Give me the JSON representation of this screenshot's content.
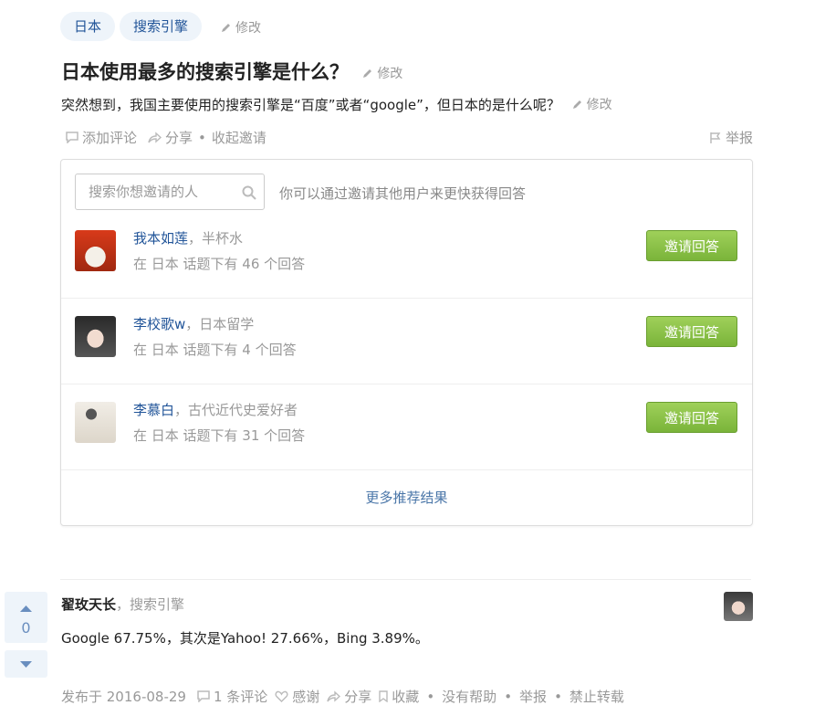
{
  "tags": [
    "日本",
    "搜索引擎"
  ],
  "edit_label": "修改",
  "question": {
    "title": "日本使用最多的搜索引擎是什么？",
    "detail": "突然想到，我国主要使用的搜索引擎是“百度”或者“google”，但日本的是什么呢？"
  },
  "actions": {
    "comment": "添加评论",
    "share": "分享",
    "dot": "•",
    "collapse_invite": "收起邀请",
    "report": "举报"
  },
  "invite_panel": {
    "search_placeholder": "搜索你想邀请的人",
    "hint": "你可以通过邀请其他用户来更快获得回答",
    "invite_button": "邀请回答",
    "more": "更多推荐结果",
    "people": [
      {
        "name": "我本如莲",
        "sep": "，",
        "bio": "半杯水",
        "stat": "在 日本 话题下有 46 个回答"
      },
      {
        "name": "李校歌w",
        "sep": "，",
        "bio": "日本留学",
        "stat": "在 日本 话题下有 4 个回答"
      },
      {
        "name": "李慕白",
        "sep": "，",
        "bio": "古代近代史爱好者",
        "stat": "在 日本 话题下有 31 个回答"
      }
    ]
  },
  "answer": {
    "vote_count": "0",
    "author": "翟玫天长",
    "sep": "，",
    "author_bio": "搜索引擎",
    "content": "Google 67.75%，其次是Yahoo! 27.66%，Bing 3.89%。",
    "footer": {
      "published": "发布于 2016-08-29",
      "comments": "1 条评论",
      "thanks": "感谢",
      "share": "分享",
      "collect": "收藏",
      "dot": "•",
      "not_helpful": "没有帮助",
      "report": "举报",
      "no_repost": "禁止转载"
    }
  },
  "colors": {
    "link": "#225599",
    "tag_bg": "#eef4fa",
    "invite_green": "#8cc14a",
    "muted": "#999999"
  }
}
